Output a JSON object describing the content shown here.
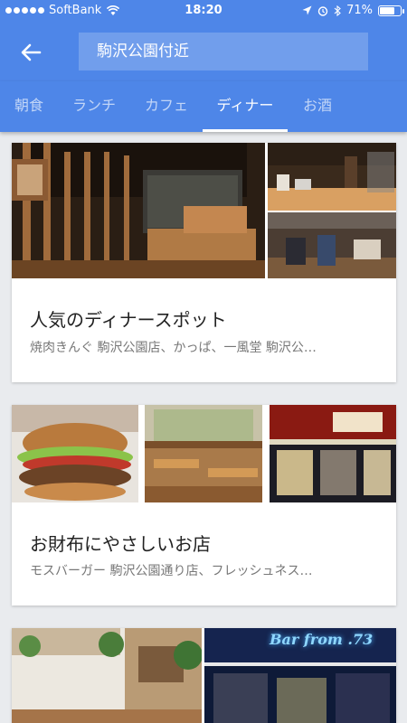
{
  "status_bar": {
    "carrier": "SoftBank",
    "time": "18:20",
    "battery_text": "71%",
    "battery_level": 0.71,
    "icons": [
      "signal-dots",
      "wifi-icon",
      "location-arrow-icon",
      "alarm-icon",
      "bluetooth-icon",
      "battery-icon"
    ]
  },
  "header": {
    "back_icon": "back-arrow-icon",
    "search_text": "駒沢公園付近"
  },
  "tabs": [
    {
      "label": "朝食"
    },
    {
      "label": "ランチ"
    },
    {
      "label": "カフェ"
    },
    {
      "label": "ディナー",
      "active": true
    },
    {
      "label": "お酒"
    }
  ],
  "cards": [
    {
      "title": "人気のディナースポット",
      "subtitle": "焼肉きんぐ 駒沢公園店、かっぱ、一風堂 駒沢公…"
    },
    {
      "title": "お財布にやさしいお店",
      "subtitle": "モスバーガー 駒沢公園通り店、フレッシュネス…"
    },
    {
      "sign_text": "Bar from .73"
    }
  ],
  "colors": {
    "primary": "#4e86e8",
    "background": "#e9ebee",
    "title": "#222222",
    "subtitle": "#777777"
  }
}
